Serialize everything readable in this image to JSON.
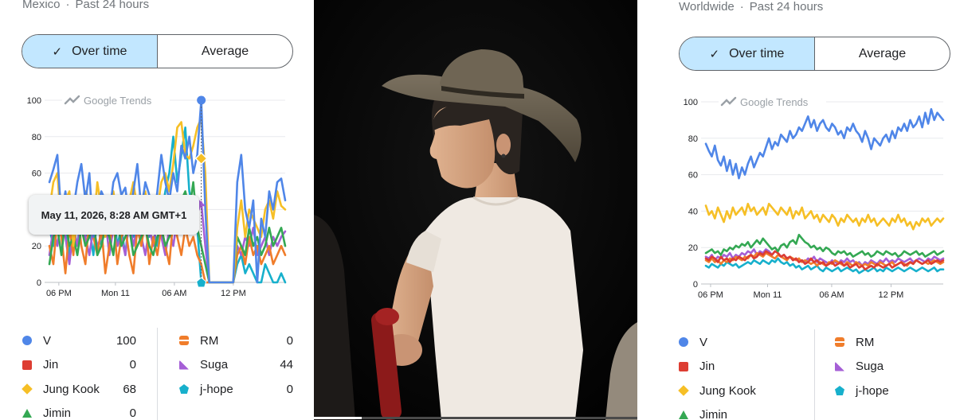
{
  "colors": {
    "v": "#4f86e8",
    "jin": "#dd3d32",
    "jungkook": "#f6bf26",
    "jimin": "#34a853",
    "rm": "#f07d2b",
    "suga": "#a55fd6",
    "jhope": "#17b0cc"
  },
  "left": {
    "region": "Mexico",
    "timeframe": "Past 24 hours",
    "separator": "·",
    "toggle": {
      "check_icon": "✓",
      "over_time": "Over time",
      "average": "Average"
    },
    "watermark": "Google Trends",
    "tooltip": "May 11, 2026, 8:28 AM GMT+1",
    "legend": [
      {
        "name": "V",
        "value": "100",
        "color": "#4f86e8",
        "shape": "circle"
      },
      {
        "name": "Jin",
        "value": "0",
        "color": "#dd3d32",
        "shape": "square"
      },
      {
        "name": "Jung Kook",
        "value": "68",
        "color": "#f6bf26",
        "shape": "diamond"
      },
      {
        "name": "Jimin",
        "value": "0",
        "color": "#34a853",
        "shape": "triangle"
      },
      {
        "name": "RM",
        "value": "0",
        "color": "#f07d2b",
        "shape": "hourglass"
      },
      {
        "name": "Suga",
        "value": "44",
        "color": "#a55fd6",
        "shape": "tri-round"
      },
      {
        "name": "j-hope",
        "value": "0",
        "color": "#17b0cc",
        "shape": "pentagon"
      }
    ]
  },
  "right": {
    "region": "Worldwide",
    "timeframe": "Past 24 hours",
    "separator": "·",
    "toggle": {
      "check_icon": "✓",
      "over_time": "Over time",
      "average": "Average"
    },
    "watermark": "Google Trends",
    "legend": [
      {
        "name": "V",
        "color": "#4f86e8",
        "shape": "circle"
      },
      {
        "name": "Jin",
        "color": "#dd3d32",
        "shape": "square"
      },
      {
        "name": "Jung Kook",
        "color": "#f6bf26",
        "shape": "diamond"
      },
      {
        "name": "Jimin",
        "color": "#34a853",
        "shape": "triangle"
      },
      {
        "name": "RM",
        "color": "#f07d2b",
        "shape": "hourglass"
      },
      {
        "name": "Suga",
        "color": "#a55fd6",
        "shape": "tri-round"
      },
      {
        "name": "j-hope",
        "color": "#17b0cc",
        "shape": "pentagon"
      }
    ]
  },
  "chart_data": [
    {
      "type": "line",
      "region": "Mexico",
      "ylim": [
        0,
        100
      ],
      "yticks": [
        0,
        20,
        40,
        60,
        80,
        100
      ],
      "xticks": [
        "06 PM",
        "Mon 11",
        "06 AM",
        "12 PM"
      ],
      "hover": {
        "time": "May 11, 2026, 8:28 AM GMT+1",
        "V": 100,
        "Jung Kook": 68,
        "Suga": 44,
        "j-hope": 0
      },
      "series": [
        {
          "name": "V",
          "values": [
            55,
            62,
            70,
            35,
            50,
            30,
            40,
            55,
            65,
            45,
            60,
            25,
            40,
            50,
            45,
            38,
            55,
            60,
            48,
            52,
            35,
            50,
            65,
            40,
            55,
            48,
            30,
            50,
            70,
            55,
            45,
            60,
            50,
            75,
            68,
            80,
            60,
            70,
            100,
            40,
            0,
            0,
            0,
            0,
            0,
            0,
            0,
            55,
            70,
            40,
            30,
            45,
            0,
            35,
            25,
            50,
            40,
            55,
            57,
            45
          ]
        },
        {
          "name": "Jung Kook",
          "values": [
            40,
            55,
            60,
            30,
            45,
            50,
            20,
            40,
            35,
            50,
            45,
            30,
            55,
            40,
            25,
            45,
            50,
            35,
            40,
            30,
            45,
            55,
            40,
            35,
            50,
            30,
            45,
            40,
            55,
            60,
            50,
            65,
            85,
            88,
            70,
            68,
            75,
            85,
            90,
            60,
            0,
            0,
            0,
            0,
            0,
            0,
            0,
            30,
            45,
            25,
            40,
            35,
            30,
            25,
            40,
            45,
            35,
            50,
            42,
            40
          ]
        },
        {
          "name": "Jimin",
          "values": [
            10,
            25,
            30,
            15,
            35,
            20,
            25,
            15,
            30,
            20,
            25,
            35,
            15,
            20,
            30,
            25,
            15,
            35,
            20,
            25,
            30,
            15,
            20,
            25,
            30,
            20,
            15,
            25,
            30,
            20,
            25,
            30,
            35,
            45,
            50,
            40,
            55,
            30,
            20,
            10,
            0,
            0,
            0,
            0,
            0,
            0,
            0,
            25,
            20,
            15,
            30,
            20,
            25,
            15,
            20,
            30,
            20,
            25,
            30,
            20
          ]
        },
        {
          "name": "RM",
          "values": [
            20,
            10,
            35,
            25,
            5,
            30,
            15,
            40,
            20,
            10,
            35,
            25,
            15,
            30,
            5,
            20,
            35,
            10,
            25,
            30,
            15,
            5,
            30,
            20,
            35,
            10,
            25,
            15,
            30,
            20,
            10,
            35,
            25,
            15,
            30,
            20,
            25,
            15,
            10,
            0,
            0,
            0,
            0,
            0,
            0,
            0,
            0,
            15,
            20,
            10,
            25,
            15,
            20,
            10,
            15,
            20,
            10,
            15,
            20,
            15
          ]
        },
        {
          "name": "Suga",
          "values": [
            15,
            30,
            20,
            35,
            25,
            10,
            30,
            20,
            35,
            25,
            15,
            30,
            20,
            25,
            35,
            15,
            30,
            20,
            25,
            15,
            35,
            20,
            30,
            25,
            15,
            30,
            20,
            35,
            25,
            15,
            30,
            20,
            35,
            30,
            40,
            35,
            45,
            38,
            44,
            20,
            0,
            0,
            0,
            0,
            0,
            0,
            0,
            20,
            15,
            25,
            20,
            30,
            15,
            20,
            25,
            15,
            25,
            20,
            25,
            28
          ]
        },
        {
          "name": "j-hope",
          "values": [
            30,
            20,
            40,
            25,
            35,
            15,
            30,
            20,
            40,
            25,
            30,
            15,
            35,
            20,
            30,
            25,
            40,
            20,
            30,
            15,
            35,
            25,
            30,
            20,
            40,
            25,
            30,
            20,
            35,
            50,
            60,
            80,
            55,
            70,
            85,
            50,
            40,
            30,
            0,
            0,
            0,
            0,
            0,
            0,
            0,
            0,
            0,
            10,
            15,
            5,
            10,
            5,
            0,
            0,
            10,
            5,
            0,
            0,
            5,
            0
          ]
        }
      ]
    },
    {
      "type": "line",
      "region": "Worldwide",
      "ylim": [
        0,
        100
      ],
      "yticks": [
        0,
        20,
        40,
        60,
        80,
        100
      ],
      "xticks": [
        "06 PM",
        "Mon 11",
        "06 AM",
        "12 PM"
      ],
      "series": [
        {
          "name": "V",
          "values": [
            77,
            73,
            70,
            76,
            68,
            65,
            70,
            62,
            68,
            60,
            66,
            58,
            64,
            60,
            66,
            70,
            64,
            68,
            72,
            70,
            75,
            80,
            74,
            78,
            76,
            82,
            80,
            78,
            84,
            80,
            82,
            86,
            84,
            88,
            92,
            86,
            90,
            84,
            88,
            90,
            86,
            84,
            88,
            86,
            82,
            84,
            80,
            86,
            84,
            88,
            84,
            82,
            78,
            84,
            80,
            74,
            80,
            78,
            76,
            80,
            82,
            78,
            84,
            80,
            86,
            84,
            88,
            84,
            90,
            86,
            88,
            92,
            86,
            94,
            88,
            96,
            90,
            94,
            92,
            90
          ]
        },
        {
          "name": "Jung Kook",
          "values": [
            43,
            38,
            40,
            36,
            42,
            38,
            34,
            40,
            36,
            42,
            38,
            40,
            42,
            38,
            44,
            40,
            42,
            38,
            40,
            42,
            38,
            44,
            42,
            40,
            38,
            42,
            40,
            38,
            42,
            36,
            40,
            38,
            42,
            36,
            38,
            40,
            36,
            38,
            34,
            38,
            36,
            34,
            38,
            36,
            32,
            36,
            34,
            38,
            36,
            34,
            36,
            32,
            36,
            34,
            38,
            34,
            36,
            32,
            34,
            36,
            34,
            32,
            36,
            34,
            38,
            34,
            36,
            32,
            34,
            30,
            34,
            32,
            36,
            34,
            36,
            32,
            34,
            36,
            34,
            36
          ]
        },
        {
          "name": "Jimin",
          "values": [
            17,
            18,
            19,
            17,
            18,
            16,
            19,
            18,
            20,
            19,
            21,
            20,
            22,
            21,
            23,
            20,
            22,
            24,
            22,
            25,
            23,
            21,
            19,
            20,
            18,
            21,
            22,
            20,
            23,
            24,
            22,
            27,
            25,
            23,
            22,
            20,
            21,
            19,
            20,
            18,
            20,
            19,
            17,
            16,
            18,
            17,
            18,
            16,
            17,
            15,
            16,
            17,
            18,
            16,
            17,
            15,
            16,
            18,
            17,
            16,
            18,
            17,
            16,
            17,
            15,
            16,
            18,
            17,
            16,
            17,
            18,
            16,
            17,
            15,
            16,
            17,
            18,
            16,
            17,
            18
          ]
        },
        {
          "name": "Jin",
          "values": [
            14,
            13,
            15,
            14,
            12,
            15,
            13,
            14,
            12,
            14,
            13,
            15,
            14,
            13,
            15,
            16,
            14,
            15,
            17,
            16,
            18,
            17,
            16,
            18,
            17,
            15,
            16,
            14,
            15,
            13,
            14,
            12,
            13,
            11,
            12,
            14,
            12,
            13,
            11,
            12,
            10,
            11,
            12,
            10,
            11,
            12,
            10,
            11,
            9,
            10,
            11,
            9,
            10,
            8,
            9,
            10,
            9,
            11,
            10,
            9,
            10,
            11,
            9,
            10,
            11,
            12,
            10,
            11,
            12,
            11,
            13,
            12,
            11,
            12,
            13,
            11,
            12,
            13,
            12,
            13
          ]
        },
        {
          "name": "RM",
          "values": [
            13,
            12,
            14,
            12,
            13,
            11,
            13,
            12,
            14,
            13,
            15,
            14,
            13,
            15,
            14,
            16,
            15,
            17,
            16,
            15,
            17,
            16,
            15,
            14,
            16,
            15,
            14,
            13,
            15,
            14,
            13,
            14,
            12,
            13,
            12,
            11,
            12,
            10,
            12,
            11,
            10,
            12,
            11,
            13,
            12,
            11,
            10,
            12,
            11,
            10,
            12,
            11,
            10,
            11,
            10,
            12,
            11,
            10,
            12,
            11,
            10,
            11,
            12,
            10,
            11,
            12,
            11,
            10,
            12,
            11,
            13,
            12,
            11,
            12,
            11,
            12,
            13,
            12,
            11,
            12
          ]
        },
        {
          "name": "Suga",
          "values": [
            15,
            14,
            16,
            13,
            15,
            14,
            16,
            15,
            17,
            14,
            16,
            15,
            17,
            16,
            18,
            17,
            19,
            16,
            18,
            17,
            19,
            18,
            16,
            18,
            17,
            15,
            16,
            14,
            15,
            13,
            14,
            12,
            13,
            12,
            14,
            13,
            15,
            12,
            14,
            13,
            12,
            11,
            13,
            12,
            11,
            13,
            12,
            14,
            12,
            13,
            11,
            12,
            10,
            12,
            11,
            13,
            12,
            11,
            13,
            12,
            14,
            12,
            13,
            12,
            14,
            13,
            12,
            13,
            14,
            12,
            13,
            14,
            13,
            12,
            14,
            13,
            15,
            14,
            13,
            14
          ]
        },
        {
          "name": "j-hope",
          "values": [
            10,
            9,
            11,
            10,
            9,
            11,
            10,
            12,
            11,
            10,
            11,
            9,
            10,
            11,
            12,
            11,
            13,
            12,
            11,
            13,
            12,
            11,
            13,
            12,
            14,
            12,
            11,
            12,
            10,
            11,
            9,
            10,
            8,
            9,
            10,
            8,
            9,
            10,
            8,
            7,
            9,
            8,
            7,
            8,
            9,
            7,
            8,
            9,
            8,
            7,
            8,
            6,
            7,
            8,
            7,
            8,
            9,
            7,
            8,
            7,
            9,
            8,
            7,
            8,
            9,
            8,
            7,
            8,
            9,
            8,
            7,
            8,
            9,
            8,
            7,
            8,
            9,
            7,
            8,
            8
          ]
        }
      ]
    }
  ]
}
